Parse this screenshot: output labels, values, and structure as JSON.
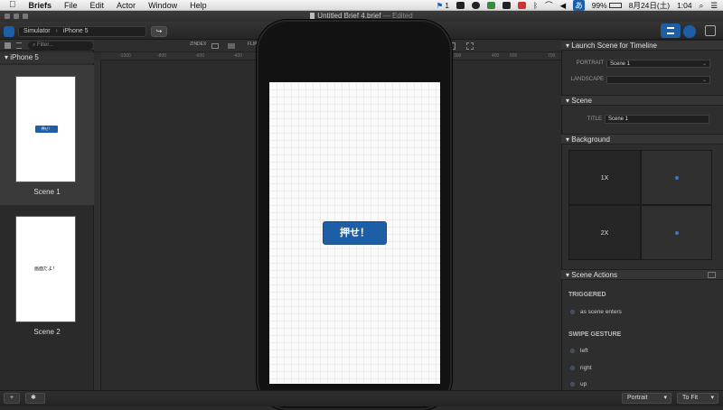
{
  "menubar": {
    "app": "Briefs",
    "items": [
      "File",
      "Edit",
      "Actor",
      "Window",
      "Help"
    ],
    "right": {
      "badge": "1",
      "battery": "99%",
      "date": "8月24日(土)",
      "time": "1:04"
    }
  },
  "window": {
    "title": "Untitled Brief 4.brief",
    "status": "— Edited"
  },
  "toolbar": {
    "breadcrumb_root": "Simulator",
    "breadcrumb_sep": "›",
    "breadcrumb_device": "iPhone 5",
    "share_icon": "↪"
  },
  "canvas_toolbar": {
    "zindex_label": "ZINDEX",
    "flip_label": "FLIP"
  },
  "ruler": {
    "ticks": [
      "-1000",
      "-800",
      "-600",
      "-400",
      "300",
      "400",
      "500",
      "600",
      "700"
    ]
  },
  "sidebar": {
    "filter_placeholder": "Filter...",
    "device": "iPhone 5",
    "scenes": [
      {
        "label": "Scene 1",
        "thumb_text": "押せ！"
      },
      {
        "label": "Scene 2",
        "thumb_text": "画面だよ！"
      }
    ]
  },
  "canvas": {
    "button_label": "押せ！"
  },
  "inspector": {
    "launch": {
      "title": "Launch Scene for Timeline",
      "portrait_label": "PORTRAIT",
      "portrait_value": "Scene 1",
      "landscape_label": "LANDSCAPE",
      "landscape_value": ""
    },
    "scene": {
      "title": "Scene",
      "title_label": "TITLE",
      "title_value": "Scene 1"
    },
    "background": {
      "title": "Background",
      "row1": "1X",
      "row2": "2X"
    },
    "actions": {
      "title": "Scene Actions",
      "triggered": "TRIGGERED",
      "on_enter": "as scene enters",
      "swipe": "SWIPE GESTURE",
      "left": "left",
      "right": "right",
      "up": "up"
    }
  },
  "bottombar": {
    "add": "+",
    "settings": "✱",
    "orientation": "Portrait",
    "zoom": "To Fit"
  },
  "colors": {
    "accent": "#1d5fa6",
    "panel": "#2e2e2e",
    "canvas_bg": "#2c2c2c"
  }
}
